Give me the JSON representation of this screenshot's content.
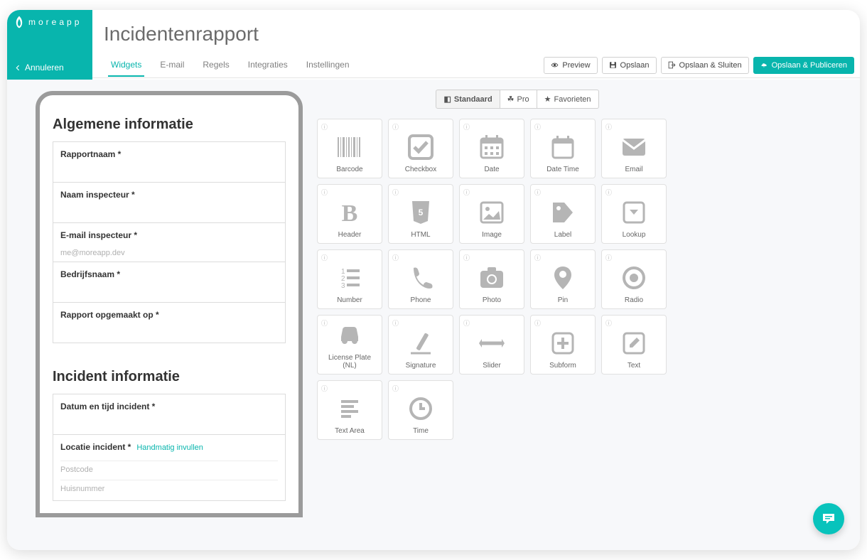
{
  "brand": "moreapp",
  "cancel_label": "Annuleren",
  "page_title": "Incidentenrapport",
  "tabs": [
    "Widgets",
    "E-mail",
    "Regels",
    "Integraties",
    "Instellingen"
  ],
  "active_tab": 0,
  "actions": {
    "preview": "Preview",
    "save": "Opslaan",
    "save_close": "Opslaan & Sluiten",
    "save_publish": "Opslaan & Publiceren"
  },
  "form": {
    "sections": [
      {
        "title": "Algemene informatie",
        "fields": [
          {
            "label": "Rapportnaam *"
          },
          {
            "label": "Naam inspecteur *"
          },
          {
            "label": "E-mail inspecteur *",
            "placeholder": "me@moreapp.dev"
          },
          {
            "label": "Bedrijfsnaam *"
          },
          {
            "label": "Rapport opgemaakt op *"
          }
        ]
      },
      {
        "title": "Incident informatie",
        "fields": [
          {
            "label": "Datum en tijd incident *"
          },
          {
            "label": "Locatie incident *",
            "link": "Handmatig invullen",
            "subfields": [
              "Postcode",
              "Huisnummer"
            ]
          }
        ]
      }
    ]
  },
  "widget_tabs": [
    {
      "label": "Standaard",
      "icon": "dashboard"
    },
    {
      "label": "Pro",
      "icon": "leaf"
    },
    {
      "label": "Favorieten",
      "icon": "star"
    }
  ],
  "active_widget_tab": 0,
  "widgets": [
    {
      "name": "Barcode",
      "icon": "barcode"
    },
    {
      "name": "Checkbox",
      "icon": "checkbox"
    },
    {
      "name": "Date",
      "icon": "calendar"
    },
    {
      "name": "Date Time",
      "icon": "calendar-o"
    },
    {
      "name": "Email",
      "icon": "email"
    },
    {
      "name": "Header",
      "icon": "header"
    },
    {
      "name": "HTML",
      "icon": "html"
    },
    {
      "name": "Image",
      "icon": "image"
    },
    {
      "name": "Label",
      "icon": "label"
    },
    {
      "name": "Lookup",
      "icon": "lookup"
    },
    {
      "name": "Number",
      "icon": "number"
    },
    {
      "name": "Phone",
      "icon": "phone"
    },
    {
      "name": "Photo",
      "icon": "photo"
    },
    {
      "name": "Pin",
      "icon": "pin"
    },
    {
      "name": "Radio",
      "icon": "radio"
    },
    {
      "name": "License Plate (NL)",
      "icon": "car"
    },
    {
      "name": "Signature",
      "icon": "signature"
    },
    {
      "name": "Slider",
      "icon": "slider"
    },
    {
      "name": "Subform",
      "icon": "subform"
    },
    {
      "name": "Text",
      "icon": "text"
    },
    {
      "name": "Text Area",
      "icon": "textarea"
    },
    {
      "name": "Time",
      "icon": "time"
    }
  ]
}
